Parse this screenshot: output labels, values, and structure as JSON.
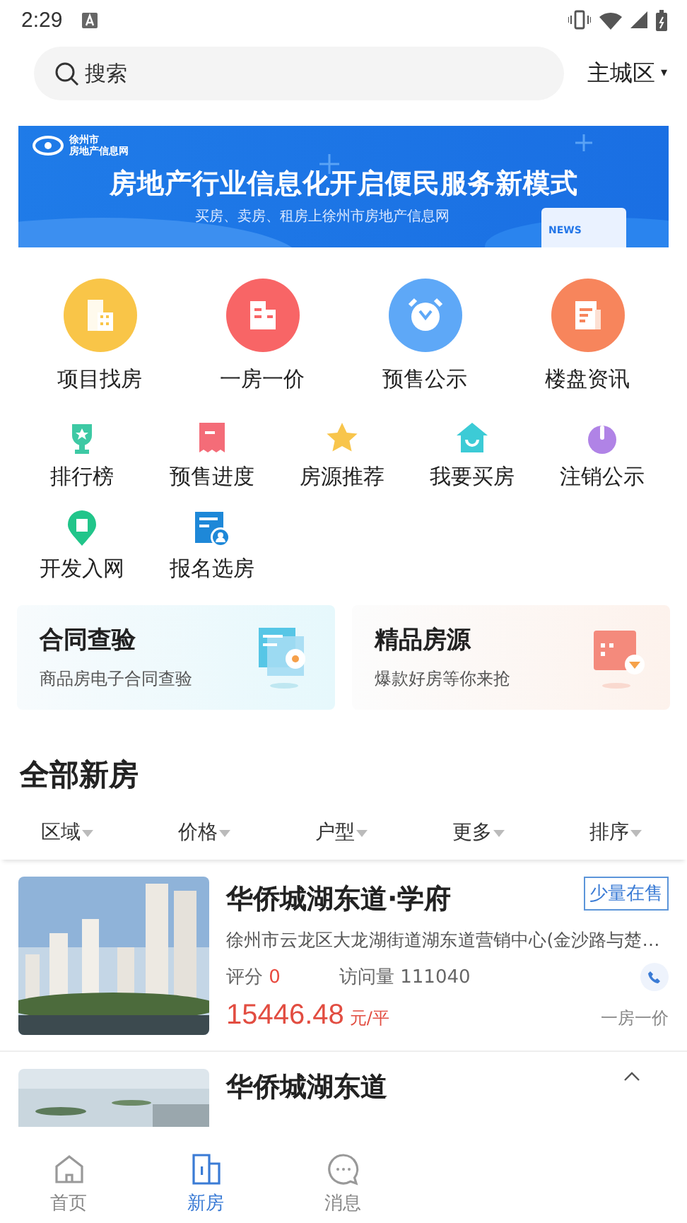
{
  "status_bar": {
    "time": "2:29"
  },
  "search": {
    "placeholder": "搜索"
  },
  "city": {
    "label": "主城区",
    "arrow": "▾"
  },
  "banner": {
    "logo_line1": "徐州市",
    "logo_line2": "房地产信息网",
    "headline": "房地产行业信息化开启便民服务新模式",
    "subline": "买房、卖房、租房上徐州市房地产信息网",
    "badge": "NEWS"
  },
  "main_shortcuts": [
    {
      "label": "项目找房",
      "kind": "building",
      "color": "#f9c548"
    },
    {
      "label": "一房一价",
      "kind": "office",
      "color": "#f86566"
    },
    {
      "label": "预售公示",
      "kind": "clock",
      "color": "#5ea8f7"
    },
    {
      "label": "楼盘资讯",
      "kind": "news",
      "color": "#f7855c"
    }
  ],
  "shortcuts": [
    {
      "label": "排行榜",
      "kind": "trophy",
      "color": "#3dc9a4"
    },
    {
      "label": "预售进度",
      "kind": "receipt",
      "color": "#f46c78"
    },
    {
      "label": "房源推荐",
      "kind": "star",
      "color": "#f8c54c"
    },
    {
      "label": "我要买房",
      "kind": "house",
      "color": "#3ccbd6"
    },
    {
      "label": "注销公示",
      "kind": "power",
      "color": "#b083e6"
    },
    {
      "label": "开发入网",
      "kind": "pin",
      "color": "#21c58a"
    },
    {
      "label": "报名选房",
      "kind": "form",
      "color": "#1e88d8"
    }
  ],
  "cards": [
    {
      "title": "合同查验",
      "subtitle": "商品房电子合同查验",
      "kind": "contract"
    },
    {
      "title": "精品房源",
      "subtitle": "爆款好房等你来抢",
      "kind": "premium"
    }
  ],
  "section_title": "全部新房",
  "filters": [
    "区域",
    "价格",
    "户型",
    "更多",
    "排序"
  ],
  "listings": [
    {
      "title": "华侨城湖东道·学府",
      "tag": "少量在售",
      "address": "徐州市云龙区大龙湖街道湖东道营销中心(金沙路与楚…",
      "rating_label": "评分",
      "rating": "0",
      "visits": "访问量 111040",
      "price": "15446.48",
      "unit": "元/平",
      "note": "一房一价",
      "kind": "full"
    },
    {
      "title": "华侨城湖东道",
      "kind": "partial"
    }
  ],
  "bottom_nav": [
    {
      "label": "首页",
      "kind": "home",
      "selected": false
    },
    {
      "label": "新房",
      "kind": "building",
      "selected": true
    },
    {
      "label": "消息",
      "kind": "chat",
      "selected": false
    }
  ]
}
